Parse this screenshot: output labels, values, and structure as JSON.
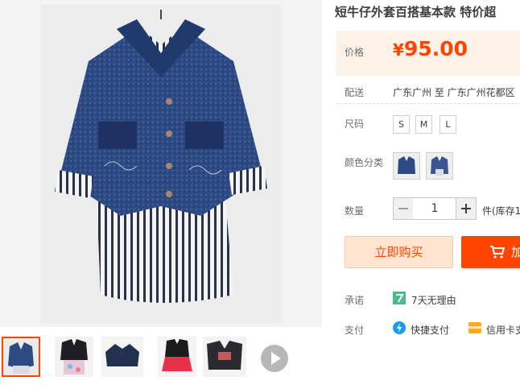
{
  "product": {
    "title": "短牛仔外套百搭基本款 特价超"
  },
  "price": {
    "label": "价格",
    "currency": "¥",
    "amount": "95.00",
    "accent_color": "#ff4400"
  },
  "shipping": {
    "label": "配送",
    "value": "广东广州 至  广东广州花都区"
  },
  "size": {
    "label": "尺码",
    "options": [
      "S",
      "M",
      "L"
    ]
  },
  "color_category": {
    "label": "颜色分类",
    "options": [
      {
        "icon": "denim-jacket-swatch-icon"
      },
      {
        "icon": "denim-jacket-swatch-icon"
      }
    ]
  },
  "quantity": {
    "label": "数量",
    "value": "1",
    "unit_stock": "件(库存1"
  },
  "actions": {
    "buy_now": "立即购买",
    "add_to_cart": "加",
    "cart_icon": "cart-icon"
  },
  "promise": {
    "label": "承诺",
    "icon": "seven-days-return-icon",
    "text": "7天无理由"
  },
  "payment": {
    "label": "支付",
    "methods": [
      {
        "icon": "quick-pay-icon",
        "text": "快捷支付"
      },
      {
        "icon": "credit-card-icon",
        "text": "信用卡支"
      }
    ]
  },
  "gallery": {
    "main_image": "denim-jacket-striped-shirt-photo",
    "thumbnails": [
      {
        "name": "denim-jacket-front",
        "active": true
      },
      {
        "name": "black-jacket-floral-skirt",
        "active": false
      },
      {
        "name": "dark-jacket-flatlay",
        "active": false
      },
      {
        "name": "black-jacket-red-skirt",
        "active": false
      },
      {
        "name": "jacket-outfit-detail",
        "active": false
      }
    ],
    "next_icon": "play-next-icon"
  }
}
